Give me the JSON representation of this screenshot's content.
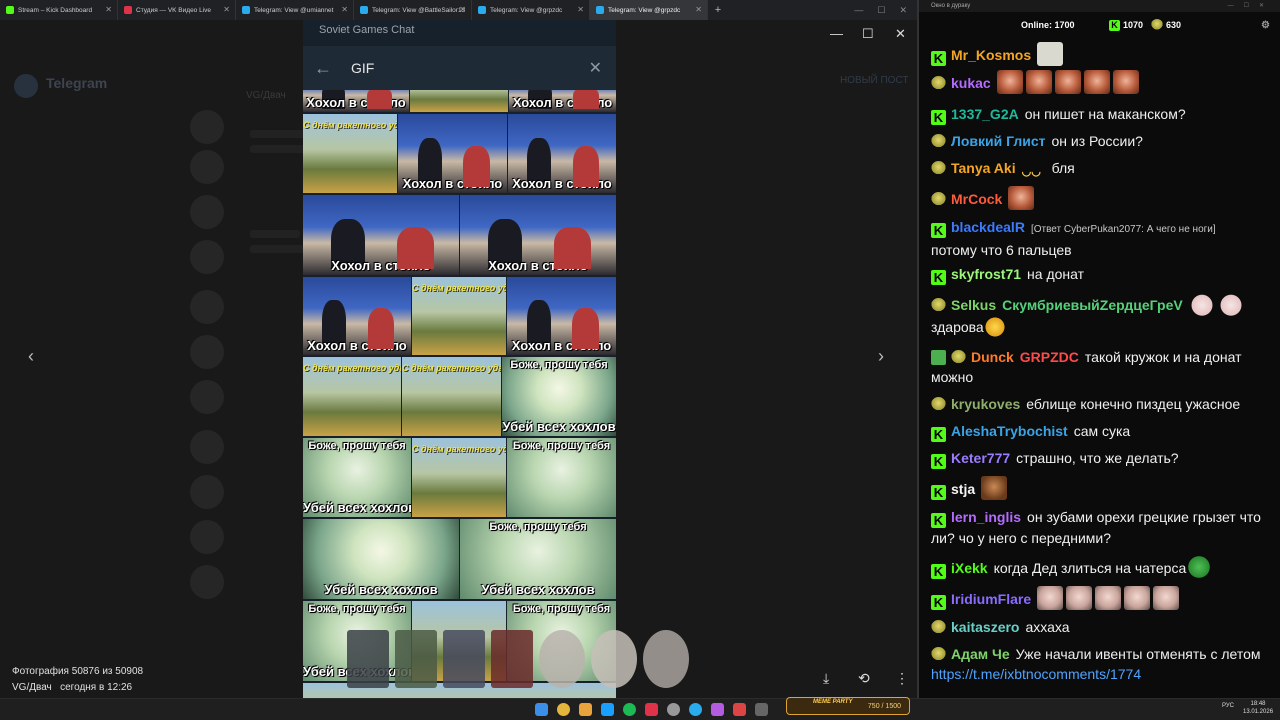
{
  "tabs": [
    {
      "label": "Stream – Kick Dashboard",
      "color": "#53fc18"
    },
    {
      "label": "Студия — VK Видео Live",
      "color": "#e0334a"
    },
    {
      "label": "Telegram: View @umiannet",
      "color": "#2aabee"
    },
    {
      "label": "Telegram: View @BattleSailor13",
      "color": "#2aabee"
    },
    {
      "label": "Telegram: View @grpzdc",
      "color": "#2aabee"
    },
    {
      "label": "Telegram: View @grpzdc",
      "color": "#2aabee"
    }
  ],
  "new_tab": "+",
  "window_controls": {
    "min": "—",
    "max": "☐",
    "close": "✕"
  },
  "background_app": {
    "title": "Telegram",
    "channel": "VG/Двач",
    "new_button": "НОВЫЙ ПОСТ"
  },
  "viewer": {
    "chat_title": "Soviet Games Chat",
    "search_back": "←",
    "search_query": "GIF",
    "search_clear": "✕",
    "prev": "‹",
    "next": "›",
    "minimize": "—",
    "maximize": "☐",
    "close": "✕",
    "photo_counter": "Фотография 50876 из 50908",
    "photo_source": "VG/Двач",
    "photo_time": "сегодня в 12:26",
    "download_icon": "⤓",
    "rotate_icon": "⟲",
    "more_icon": "⋮"
  },
  "gifs": {
    "hohol": "Хохол в стойло",
    "kiev": "С днём ракетного удара по Украине",
    "anime_top": "Боже, прошу тебя",
    "anime_bottom": "Убей всех хохлов"
  },
  "taskbar": {
    "media": "MEME PARTY",
    "media_counter": "750 / 1500",
    "lang": "РУС",
    "time": "18:48",
    "date": "13.01.2026"
  },
  "chat": {
    "window_title": "Окно в дураку",
    "online_label": "Online:",
    "online_count": "1700",
    "kick_count": "1070",
    "vk_count": "630",
    "settings_icon": "⚙",
    "messages": [
      {
        "user": "Mr_Kosmos",
        "text": "",
        "color": "#f5a623"
      },
      {
        "user": "kukac",
        "text": "",
        "color": "#b46cff"
      },
      {
        "user": "1337_G2A",
        "text": "он пишет на маканском?",
        "color": "#1fb89a"
      },
      {
        "user": "Ловкий Глист",
        "text": "он из России?",
        "color": "#3ba4e6"
      },
      {
        "user": "Tanya Aki",
        "text": "бля",
        "color": "#f5a623"
      },
      {
        "user": "MrCock",
        "text": "",
        "color": "#ff5a3a"
      },
      {
        "user": "blackdealR",
        "reply": "[Ответ CyberPukan2077: А чего не ноги]",
        "text": "потому что 6 пальцев",
        "color": "#3b7cff"
      },
      {
        "user": "skyfrost71",
        "text": "на донат",
        "color": "#9cf77a"
      },
      {
        "user": "Selkus",
        "user2": "СкумбриевыйZердцеГреV",
        "text": "здарова",
        "color": "#7fd36a",
        "color2": "#55d17a"
      },
      {
        "user": "Dunck",
        "user2": "GRPZDC",
        "text": "такой кружок и на донат можно",
        "color": "#ff7a2a",
        "color2": "#ff4a4a"
      },
      {
        "user": "kryukoves",
        "text": "еблище конечно пиздец ужасное",
        "color": "#8fae6a"
      },
      {
        "user": "AleshaTrybochist",
        "text": "сам сука",
        "color": "#3ba4e6"
      },
      {
        "user": "Keter777",
        "text": "страшно, что же делать?",
        "color": "#9b7bff"
      },
      {
        "user": "stja",
        "text": "",
        "color": "#f5f5f5"
      },
      {
        "user": "lern_inglis",
        "text": "он зубами орехи грецкие грызет что ли? чо у него с передними?",
        "color": "#b46cff"
      },
      {
        "user": "iXekk",
        "text": "когда Дед злиться на чатерса",
        "color": "#53fc18"
      },
      {
        "user": "IridiumFlare",
        "text": "",
        "color": "#8a6cff"
      },
      {
        "user": "kaitaszero",
        "text": "аххаха",
        "color": "#6ad0c6"
      },
      {
        "user": "Адам Че",
        "text": "Уже начали ивенты отменять с летом",
        "color": "#7fd36a",
        "link": "https://t.me/ixbtnocomments/1774"
      }
    ]
  }
}
